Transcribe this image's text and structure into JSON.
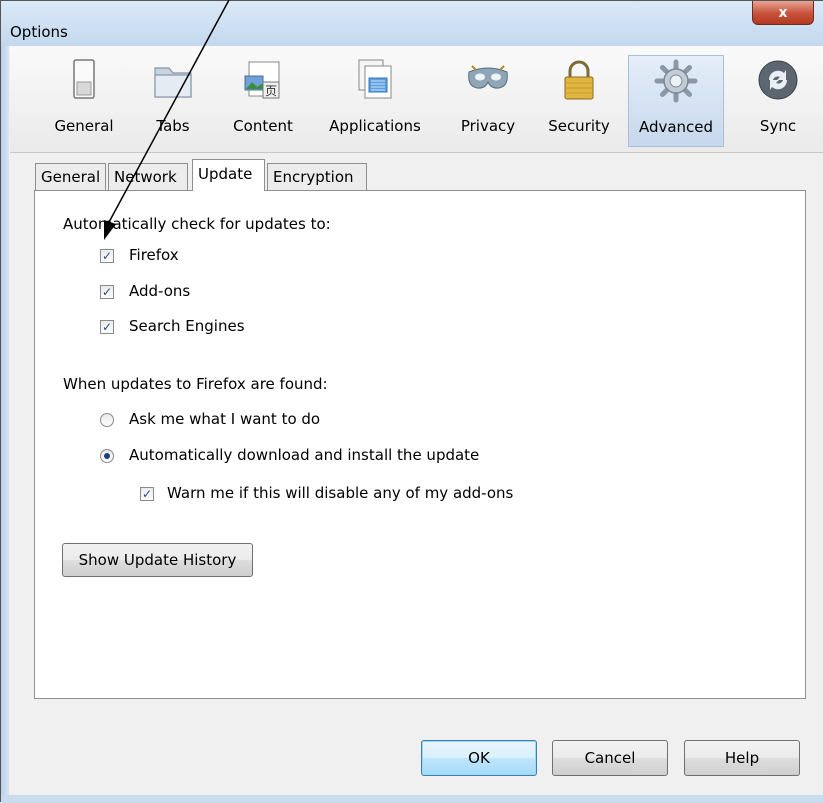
{
  "window": {
    "title": "Options",
    "close_label": "x"
  },
  "toolbar": {
    "panes": [
      {
        "label": "General",
        "icon": "switch-icon"
      },
      {
        "label": "Tabs",
        "icon": "folder-icon"
      },
      {
        "label": "Content",
        "icon": "content-icon"
      },
      {
        "label": "Applications",
        "icon": "applications-icon"
      },
      {
        "label": "Privacy",
        "icon": "mask-icon"
      },
      {
        "label": "Security",
        "icon": "padlock-icon"
      },
      {
        "label": "Advanced",
        "icon": "gear-icon",
        "selected": true
      },
      {
        "label": "Sync",
        "icon": "sync-icon"
      }
    ]
  },
  "subtabs": [
    "General",
    "Network",
    "Update",
    "Encryption"
  ],
  "active_subtab": "Update",
  "update": {
    "check_heading": "Automatically check for updates to:",
    "checkboxes": [
      {
        "label": "Firefox",
        "checked": true
      },
      {
        "label": "Add-ons",
        "checked": true
      },
      {
        "label": "Search Engines",
        "checked": true
      }
    ],
    "found_heading": "When updates to Firefox are found:",
    "radios": [
      {
        "label": "Ask me what I want to do",
        "selected": false
      },
      {
        "label": "Automatically download and install the update",
        "selected": true
      }
    ],
    "warn_checkbox": {
      "label": "Warn me if this will disable any of my add-ons",
      "checked": true
    },
    "history_button": "Show Update History"
  },
  "buttons": {
    "ok": "OK",
    "cancel": "Cancel",
    "help": "Help"
  },
  "check_mark": "✓",
  "colors": {
    "selected_pane": "#c6d8ec",
    "close_button": "#c7513a",
    "titlebar": "#c3d8ee",
    "check_mark": "#2a4a8f"
  }
}
